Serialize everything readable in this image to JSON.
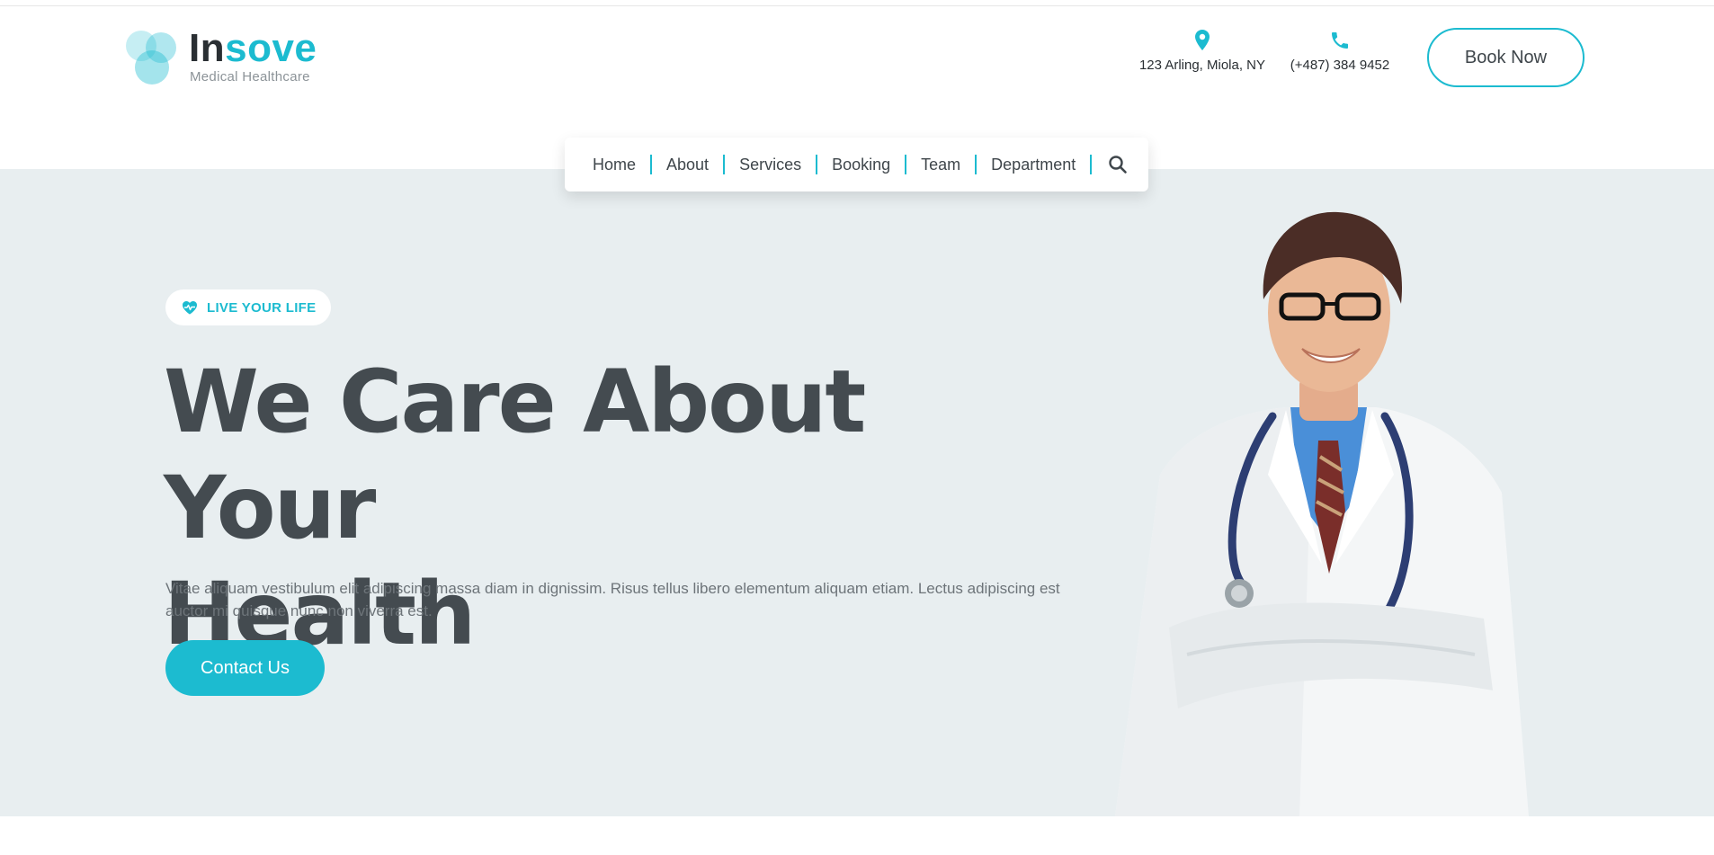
{
  "brand": {
    "name_part1": "In",
    "name_part2": "sove",
    "tagline": "Medical Healthcare",
    "accent_color": "#1cbbd0"
  },
  "header": {
    "address": {
      "icon": "map-pin-icon",
      "text": "123 Arling, Miola, NY"
    },
    "phone": {
      "icon": "phone-icon",
      "text": "(+487) 384 9452"
    },
    "book_button": "Book Now"
  },
  "nav": {
    "items": [
      {
        "label": "Home"
      },
      {
        "label": "About"
      },
      {
        "label": "Services"
      },
      {
        "label": "Booking"
      },
      {
        "label": "Team"
      },
      {
        "label": "Department"
      }
    ],
    "search_icon": "search-icon"
  },
  "hero": {
    "badge": {
      "icon": "heartbeat-icon",
      "label": "LIVE YOUR LIFE"
    },
    "headline_line1": "We Care About Your",
    "headline_line2": "Health",
    "description": "Vitae aliquam vestibulum elit adipiscing massa diam in dignissim. Risus tellus libero elementum aliquam etiam. Lectus adipiscing est auctor mi quisque nunc non viverra est.",
    "cta_button": "Contact Us",
    "background_color": "#e8eef0"
  }
}
